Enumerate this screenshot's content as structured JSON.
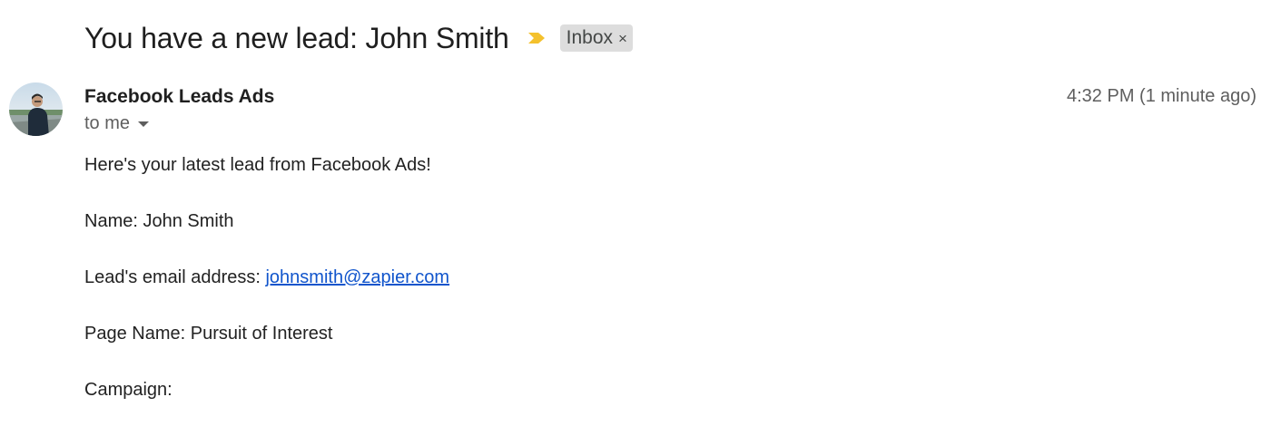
{
  "email": {
    "subject": "You have a new lead: John Smith",
    "importance_icon": "important-marker-icon",
    "label": {
      "text": "Inbox",
      "close": "×"
    },
    "sender": {
      "name": "Facebook Leads Ads",
      "avatar": "sender-avatar-photo"
    },
    "recipient": {
      "text": "to me"
    },
    "timestamp": "4:32 PM (1 minute ago)",
    "body": {
      "intro": "Here's your latest lead from Facebook Ads!",
      "name_line": "Name: John Smith",
      "email_label": "Lead's email address: ",
      "email_link": "johnsmith@zapier.com",
      "page_line": "Page Name: Pursuit of Interest",
      "campaign_line": "Campaign:"
    }
  },
  "colors": {
    "importance": "#f4c12d",
    "link": "#1155cc",
    "chip_bg": "#dddddd"
  }
}
